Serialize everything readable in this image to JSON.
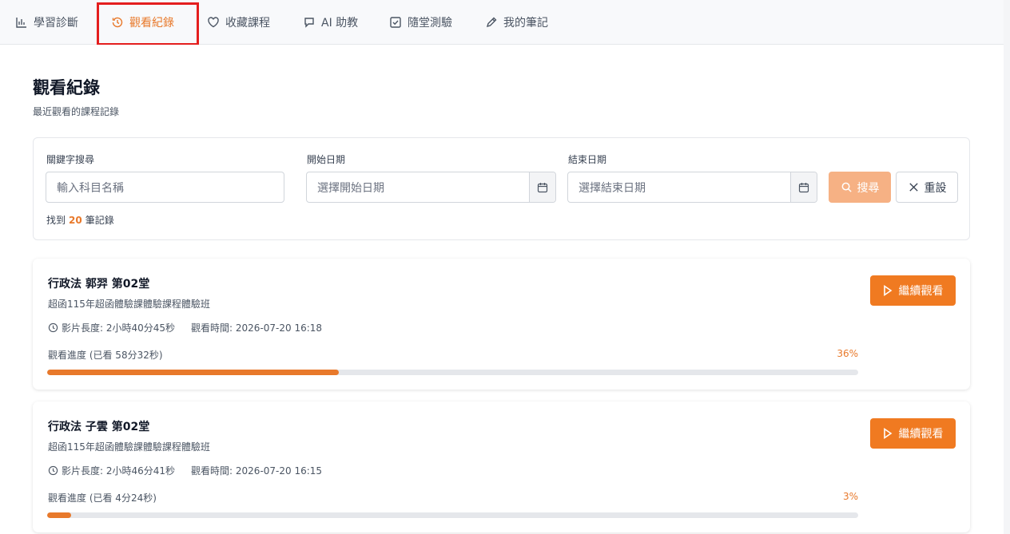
{
  "tabs": [
    {
      "label": "學習診斷",
      "icon": "bar-chart-icon"
    },
    {
      "label": "觀看紀錄",
      "icon": "history-icon"
    },
    {
      "label": "收藏課程",
      "icon": "heart-icon"
    },
    {
      "label": "AI 助教",
      "icon": "chat-bubble-icon"
    },
    {
      "label": "隨堂測驗",
      "icon": "checkbox-icon"
    },
    {
      "label": "我的筆記",
      "icon": "pencil-icon"
    }
  ],
  "page": {
    "title": "觀看紀錄",
    "subtitle": "最近觀看的課程記錄"
  },
  "filters": {
    "keyword_label": "關鍵字搜尋",
    "keyword_placeholder": "輸入科目名稱",
    "start_label": "開始日期",
    "start_placeholder": "選擇開始日期",
    "end_label": "結束日期",
    "end_placeholder": "選擇結束日期",
    "search_label": "搜尋",
    "reset_label": "重設",
    "found_prefix": "找到",
    "found_count": "20",
    "found_suffix": "筆記錄"
  },
  "records": [
    {
      "title": "行政法 郭羿 第02堂",
      "subtitle": "超函115年超函體驗課體驗課程體驗班",
      "duration": "影片長度: 2小時40分45秒",
      "watched_at": "觀看時間: 2026-07-20 16:18",
      "progress_label": "觀看進度 (已看 58分32秒)",
      "progress_text": "36%",
      "progress": 36,
      "button": "繼續觀看"
    },
    {
      "title": "行政法 子雲 第02堂",
      "subtitle": "超函115年超函體驗課體驗課程體驗班",
      "duration": "影片長度: 2小時46分41秒",
      "watched_at": "觀看時間: 2026-07-20 16:15",
      "progress_label": "觀看進度 (已看 4分24秒)",
      "progress_text": "3%",
      "progress": 3,
      "button": "繼續觀看"
    }
  ],
  "colors": {
    "accent": "#e8792b",
    "highlight": "#e41e1e"
  }
}
